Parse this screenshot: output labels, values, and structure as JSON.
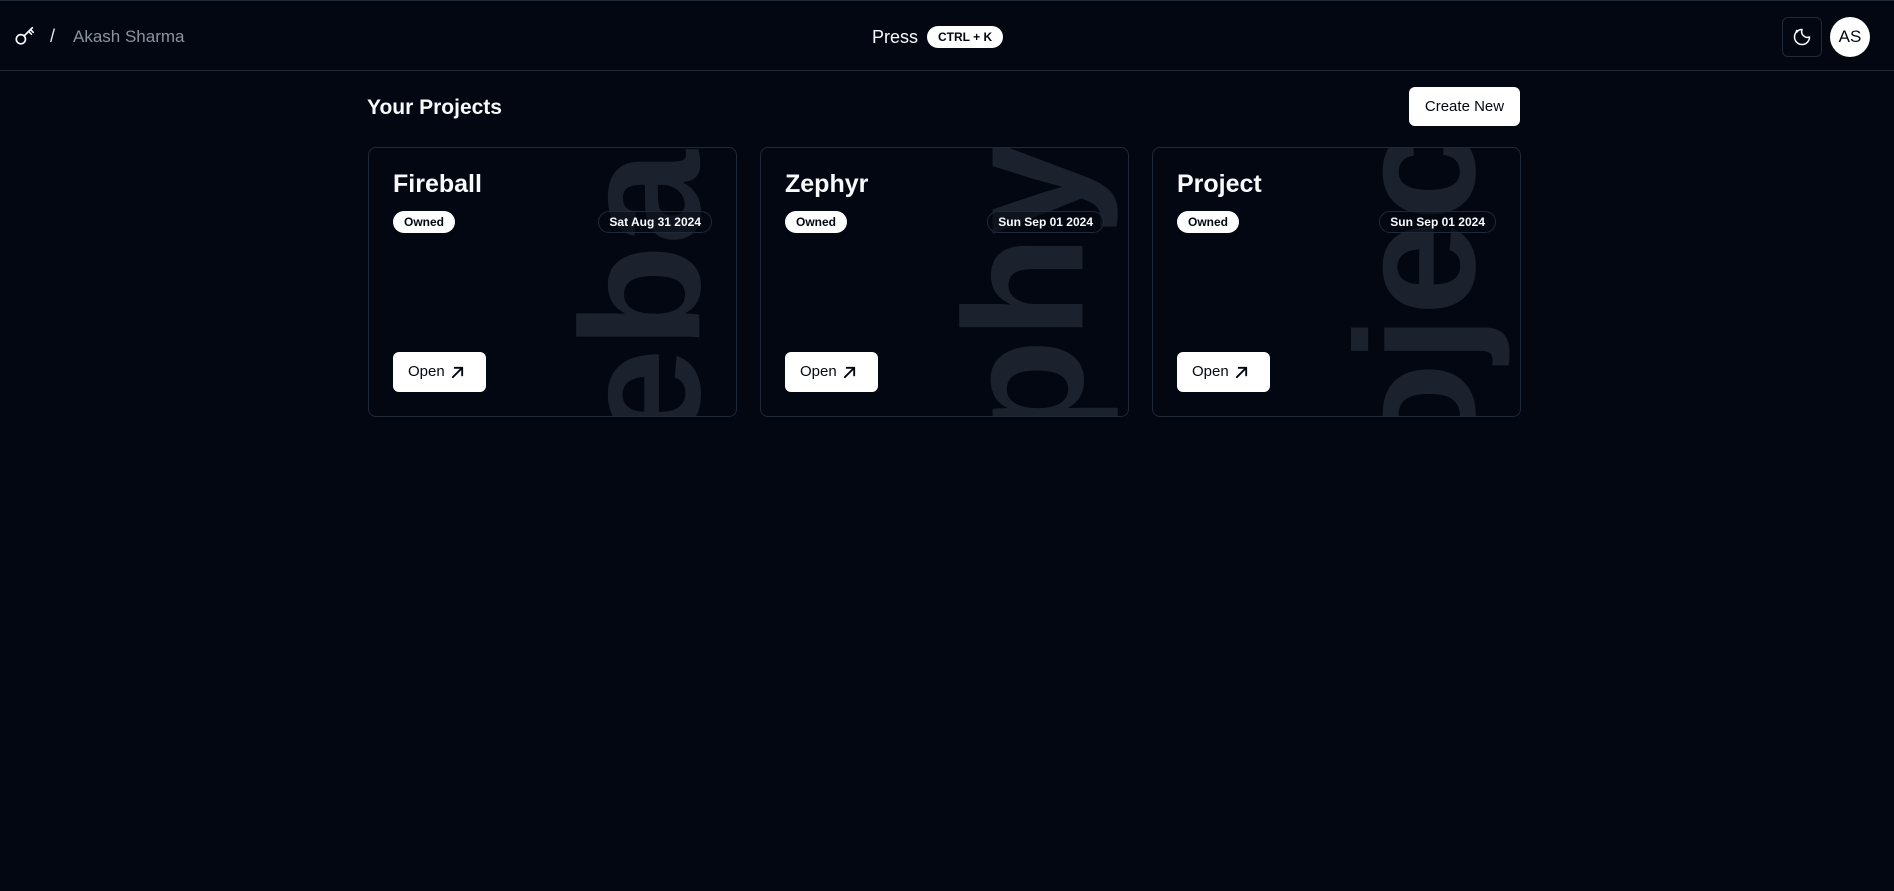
{
  "header": {
    "breadcrumb_separator": "/",
    "user_name": "Akash Sharma",
    "press_label": "Press",
    "shortcut": "CTRL + K",
    "avatar_initials": "AS"
  },
  "main": {
    "title": "Your Projects",
    "create_label": "Create New"
  },
  "projects": [
    {
      "name": "Fireball",
      "badge": "Owned",
      "date": "Sat Aug 31 2024",
      "open_label": "Open",
      "watermark": "Fireball"
    },
    {
      "name": "Zephyr",
      "badge": "Owned",
      "date": "Sun Sep 01 2024",
      "open_label": "Open",
      "watermark": "Zephyr"
    },
    {
      "name": "Project",
      "badge": "Owned",
      "date": "Sun Sep 01 2024",
      "open_label": "Open",
      "watermark": "Project"
    }
  ],
  "icons": {
    "brand": "key-icon",
    "theme_toggle": "moon-icon",
    "open": "arrow-up-right-icon"
  },
  "colors": {
    "background": "#030712",
    "border": "#1f2937",
    "accent": "#ffffff",
    "muted_text": "#8b93a1"
  }
}
